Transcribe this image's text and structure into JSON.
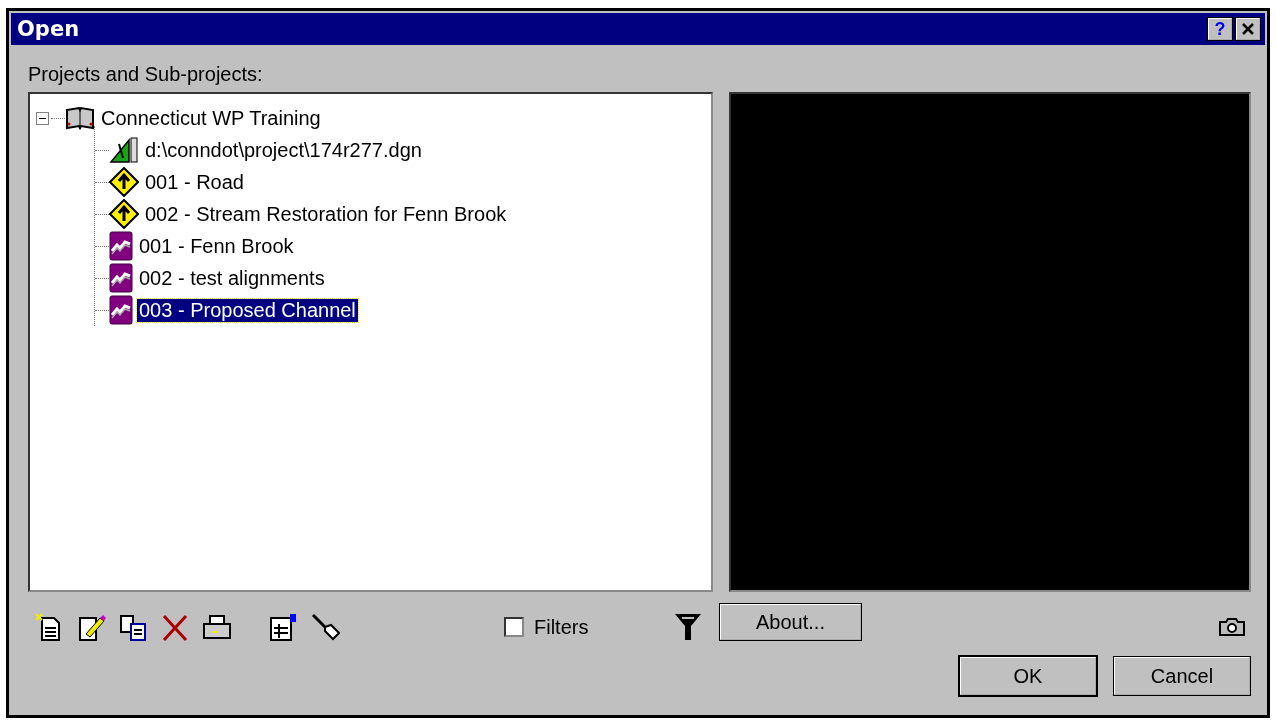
{
  "window": {
    "title": "Open",
    "help_button": "?"
  },
  "tree_label": "Projects and Sub-projects:",
  "tree": [
    {
      "label": "Connecticut WP Training",
      "kind": "book",
      "expanded": true,
      "selected": false,
      "children": [
        {
          "label": "d:\\conndot\\project\\174r277.dgn",
          "kind": "drawing",
          "selected": false
        },
        {
          "label": "001 - Road",
          "kind": "sign",
          "selected": false
        },
        {
          "label": "002 - Stream Restoration for Fenn Brook",
          "kind": "sign",
          "selected": false
        },
        {
          "label": "001 - Fenn Brook",
          "kind": "alignment",
          "selected": false
        },
        {
          "label": "002 - test alignments",
          "kind": "alignment",
          "selected": false
        },
        {
          "label": "003 - Proposed Channel",
          "kind": "alignment",
          "selected": true
        }
      ]
    }
  ],
  "toolbar": [
    {
      "kind": "new"
    },
    {
      "kind": "edit"
    },
    {
      "kind": "copy"
    },
    {
      "kind": "delete"
    },
    {
      "kind": "print"
    },
    {
      "kind": "gap"
    },
    {
      "kind": "properties"
    },
    {
      "kind": "connect"
    }
  ],
  "filters": {
    "label": "Filters",
    "checked": false
  },
  "about_button": "About...",
  "buttons": [
    "OK",
    "Cancel"
  ]
}
